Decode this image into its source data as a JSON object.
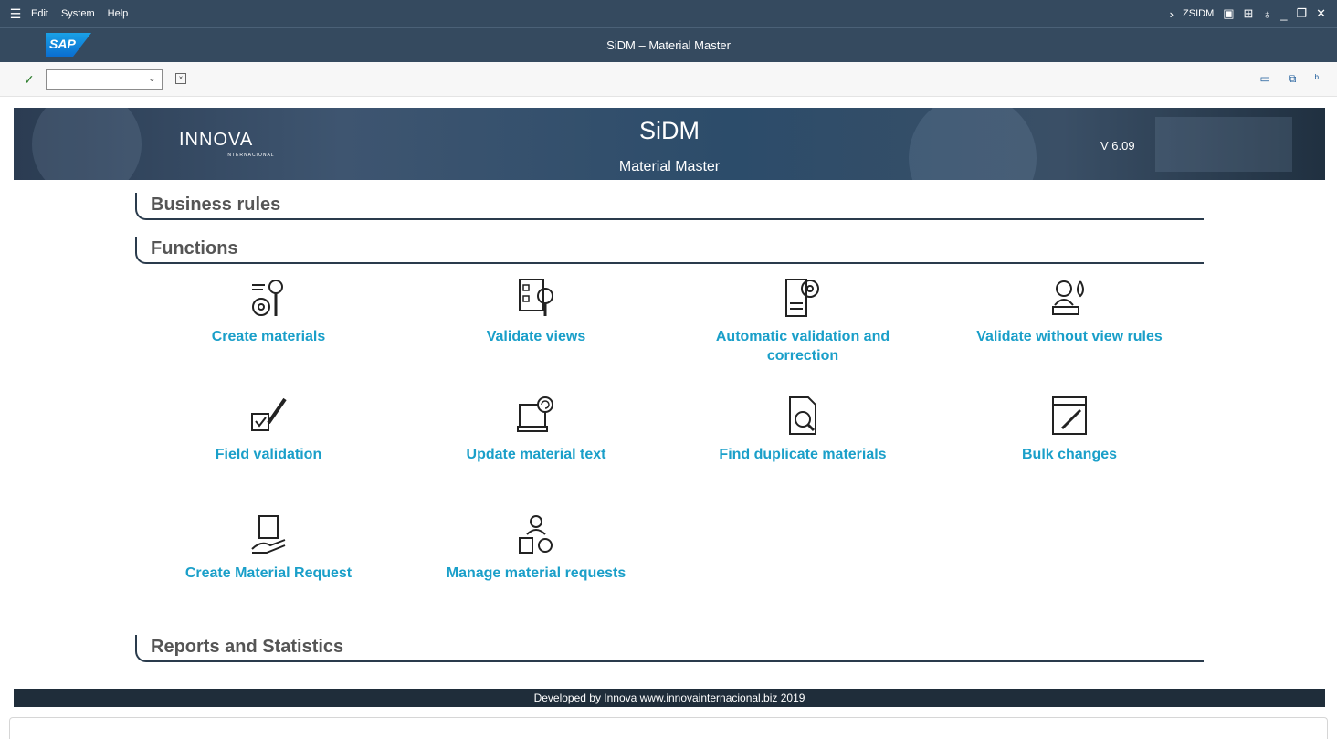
{
  "menubar": {
    "items": [
      {
        "label": "Edit"
      },
      {
        "label": "System"
      },
      {
        "label": "Help"
      }
    ],
    "transaction": "ZSIDM"
  },
  "titlebar": {
    "logo_text": "SAP",
    "title": "SiDM – Material Master"
  },
  "banner": {
    "logo_text": "INNOVA",
    "logo_sub": "INTERNACIONAL",
    "app_name": "SiDM",
    "app_subtitle": "Material Master",
    "version": "V 6.09"
  },
  "sections": {
    "business_rules": "Business rules",
    "functions": "Functions",
    "reports": "Reports and Statistics"
  },
  "functions": [
    {
      "label": "Create materials",
      "icon": "gear-pencil-icon"
    },
    {
      "label": "Validate views",
      "icon": "checklist-magnifier-icon"
    },
    {
      "label": "Automatic validation and correction",
      "icon": "document-gear-icon"
    },
    {
      "label": "Validate without view rules",
      "icon": "person-stamp-icon"
    },
    {
      "label": "Field validation",
      "icon": "checkbox-pen-icon"
    },
    {
      "label": "Update material text",
      "icon": "laptop-refresh-icon"
    },
    {
      "label": "Find duplicate materials",
      "icon": "document-search-icon"
    },
    {
      "label": "Bulk changes",
      "icon": "browser-edit-icon"
    },
    {
      "label": "Create Material Request",
      "icon": "hand-card-icon"
    },
    {
      "label": "Manage material requests",
      "icon": "user-document-gear-icon"
    }
  ],
  "footer": {
    "text": "Developed by Innova www.innovainternacional.biz 2019"
  }
}
